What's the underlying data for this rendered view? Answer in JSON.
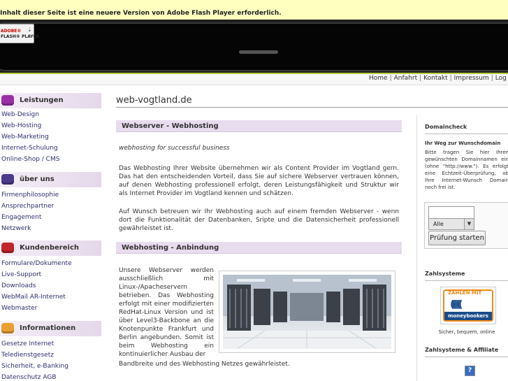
{
  "flash": {
    "message": "Inhalt dieser Seite ist eine neuere Version von Adobe Flash Player erforderlich.",
    "badge_line1": "ADOBE®",
    "badge_line2": "FLASH® PLAYER"
  },
  "topnav": {
    "items": [
      "Home",
      "Anfahrt",
      "Kontakt",
      "Impressum",
      "Log"
    ],
    "separator": "|"
  },
  "sidebar": {
    "sections": [
      {
        "title": "Leistungen",
        "color": "#9b2fa8",
        "links": [
          "Web-Design",
          "Web-Hosting",
          "Web-Marketing",
          "Internet-Schulung",
          "Online-Shop / CMS"
        ]
      },
      {
        "title": "über uns",
        "color": "#4a3a8a",
        "links": [
          "Firmenphilosophie",
          "Ansprechpartner",
          "Engagement",
          "Netzwerk"
        ]
      },
      {
        "title": "Kundenbereich",
        "color": "#c0262b",
        "links": [
          "Formulare/Dokumente",
          "Live-Support",
          "Downloads",
          "WebMail AR-Internet",
          "Webmaster"
        ]
      },
      {
        "title": "Informationen",
        "color": "#e8a030",
        "links": [
          "Gesetze Internet",
          "Teledienstgesetz",
          "Sicherheit, e-Banking",
          "Datenschutz AGB"
        ]
      }
    ]
  },
  "main": {
    "site_title": "web-vogtland.de",
    "section1_title": "Webserver - Webhosting",
    "tagline": "webhosting for successful business",
    "para1": "Das Webhosting Ihrer Website übernehmen wir als Content Provider im Vogtland gern. Das hat den entscheidenden Vorteil, dass Sie auf sichere Webserver vertrauen können, auf denen Webhosting professionell erfolgt, deren Leistungsfähigkeit und Struktur wir als Internet Provider im Vogtland kennen und schätzen.",
    "para2": "Auf Wunsch betreuen wir Ihr Webhosting auch auf einem fremden Webserver - wenn dort die Funktionalität der Datenbanken, Sripte und die Datensicherheit professionell gewährleistet ist.",
    "section2_title": "Webhosting - Anbindung",
    "para3": "Unsere Webserver werden ausschließlich mit Linux-/Apacheservern betrieben. Das Webhosting erfolgt mit einer modifizierten RedHat-Linux Version und ist über Level3-Backbone an die Knotenpunkte Frankfurt und Berlin angebunden. Somit ist beim Webhosting ein kontinuierlicher Ausbau der",
    "para3_tail": "Bandbreite und des Webhosting Netzes gewährleistet."
  },
  "right": {
    "domaincheck_title": "Domaincheck",
    "domaincheck_sub": "Ihr Weg zur Wunschdomain",
    "domaincheck_text": "Bitte tragen Sie hier Ihren gewünschten Domainnamen ein (ohne \"http://www.\"). Es erfolgt eine Echtzeit-Überprüfung, ob Ihre Internet-Wunsch Domain noch frei ist.",
    "domain_input_value": "",
    "tld_select_value": "Alle",
    "check_button": "Prüfung starten",
    "zahlsysteme_title": "Zahlsysteme",
    "moneybookers_top": "ZAHLEN MIT",
    "moneybookers_name": "moneybookers",
    "moneybookers_caption": "Sicher, bequem, online",
    "zahlsysteme_affiliate_title": "Zahlsysteme & Affiliate",
    "help_icon_glyph": "?"
  }
}
